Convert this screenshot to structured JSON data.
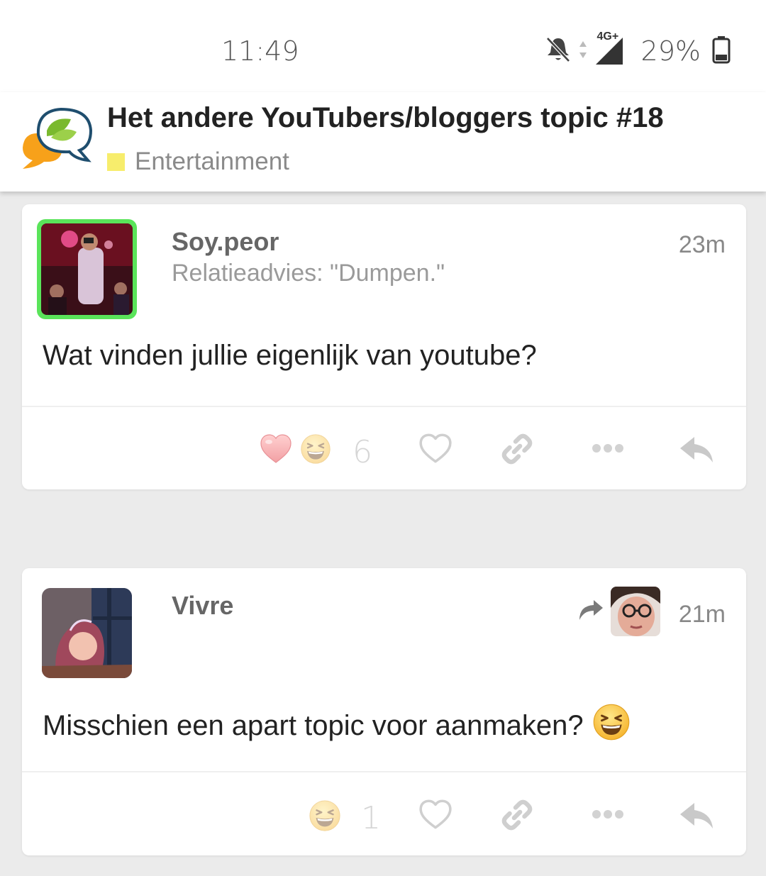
{
  "status_bar": {
    "time": "11:49",
    "network": "4G+",
    "battery": "29%",
    "icons": [
      "bell-off-icon",
      "signal-icon",
      "battery-icon"
    ]
  },
  "topic": {
    "title": "Het andere YouTubers/bloggers topic #18",
    "category": "Entertainment",
    "category_color": "#f7ed6c",
    "logo_icon": "forum-logo-icon"
  },
  "posts": [
    {
      "username": "Soy.peor",
      "user_title": "Relatieadvies: \"Dumpen.\"",
      "time": "23m",
      "body": "Wat vinden jullie eigenlijk van youtube?",
      "reactions": [
        "heart-reaction-icon",
        "laughing-reaction-icon"
      ],
      "reaction_count": "6",
      "online_indicator_color": "#5ae45a"
    },
    {
      "username": "Vivre",
      "time": "21m",
      "body": "Misschien een apart topic voor aanmaken?",
      "body_emoji": "laughing-emoji-icon",
      "reactions": [
        "laughing-reaction-icon"
      ],
      "reaction_count": "1",
      "reply_to_icon": "share-arrow-icon"
    }
  ],
  "action_icons": [
    "like-heart-icon",
    "link-icon",
    "more-icon",
    "reply-icon"
  ],
  "colors": {
    "accent": "#e45735",
    "muted": "#c8c8c8"
  }
}
